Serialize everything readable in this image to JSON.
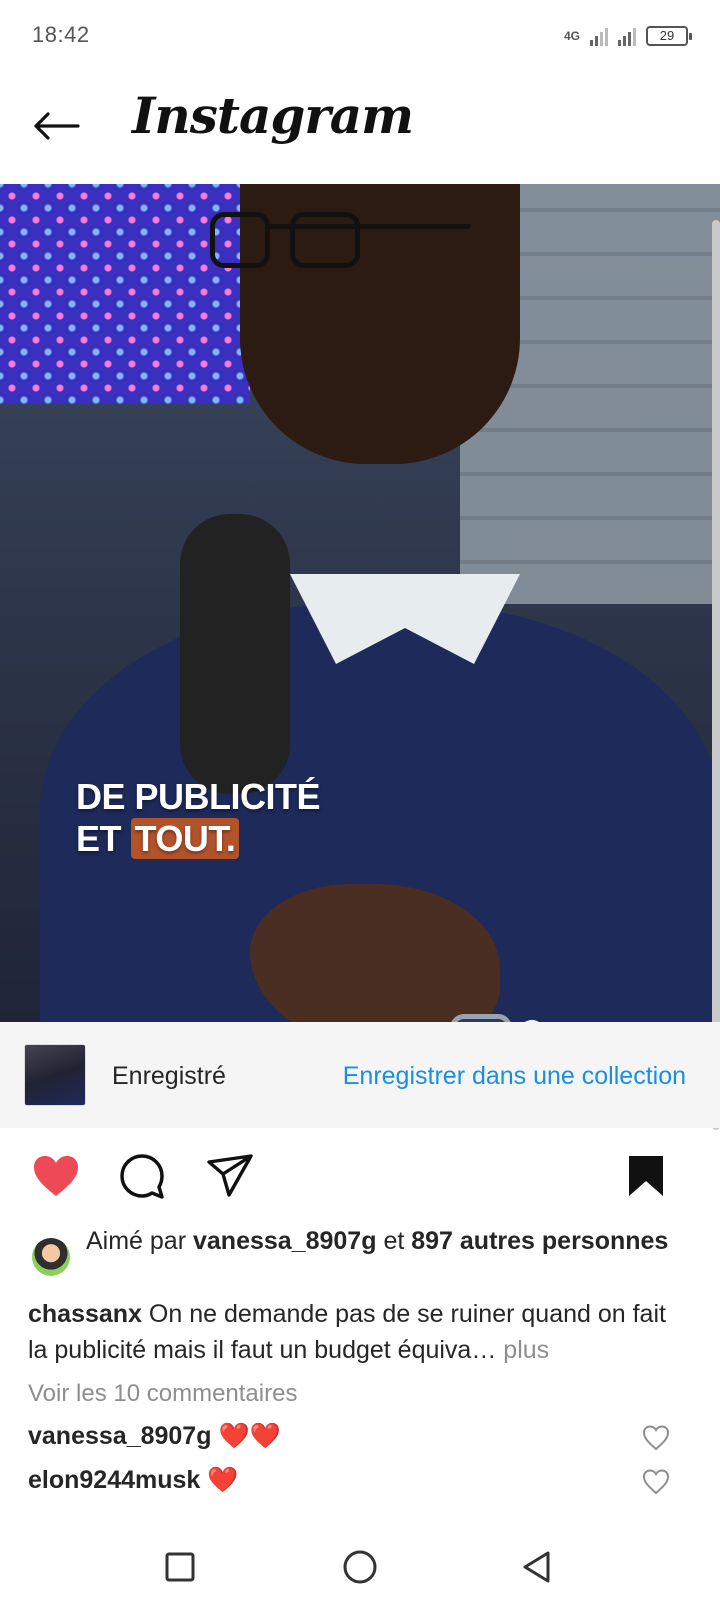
{
  "status_bar": {
    "time": "18:42",
    "network": "4G",
    "battery": "29"
  },
  "header": {
    "brand": "Instagram",
    "back_icon": "arrow-left-icon"
  },
  "media": {
    "overlay_line1": "DE PUBLICITÉ",
    "overlay_line2_prefix": "ET",
    "overlay_line2_highlight": "TOUT."
  },
  "saved_bar": {
    "status": "Enregistré",
    "collection_link": "Enregistrer dans une collection"
  },
  "actions": {
    "like_icon": "heart-filled-icon",
    "comment_icon": "comment-icon",
    "share_icon": "send-icon",
    "bookmark_icon": "bookmark-filled-icon",
    "like_color": "#ed4956"
  },
  "likes": {
    "prefix": "Aimé par",
    "user": "vanessa_8907g",
    "connector": "et",
    "others": "897 autres personnes"
  },
  "caption": {
    "username": "chassanx",
    "text": "On ne demande pas de se ruiner quand on fait la publicité mais il faut un budget équiva…",
    "more": "plus"
  },
  "comments": {
    "view_all": "Voir les 10 commentaires",
    "items": [
      {
        "user": "vanessa_8907g",
        "text": "❤️❤️"
      },
      {
        "user": "elon9244musk",
        "text": "❤️"
      }
    ]
  },
  "navbar": {
    "recents_icon": "square-icon",
    "home_icon": "circle-icon",
    "back_icon": "triangle-back-icon"
  }
}
